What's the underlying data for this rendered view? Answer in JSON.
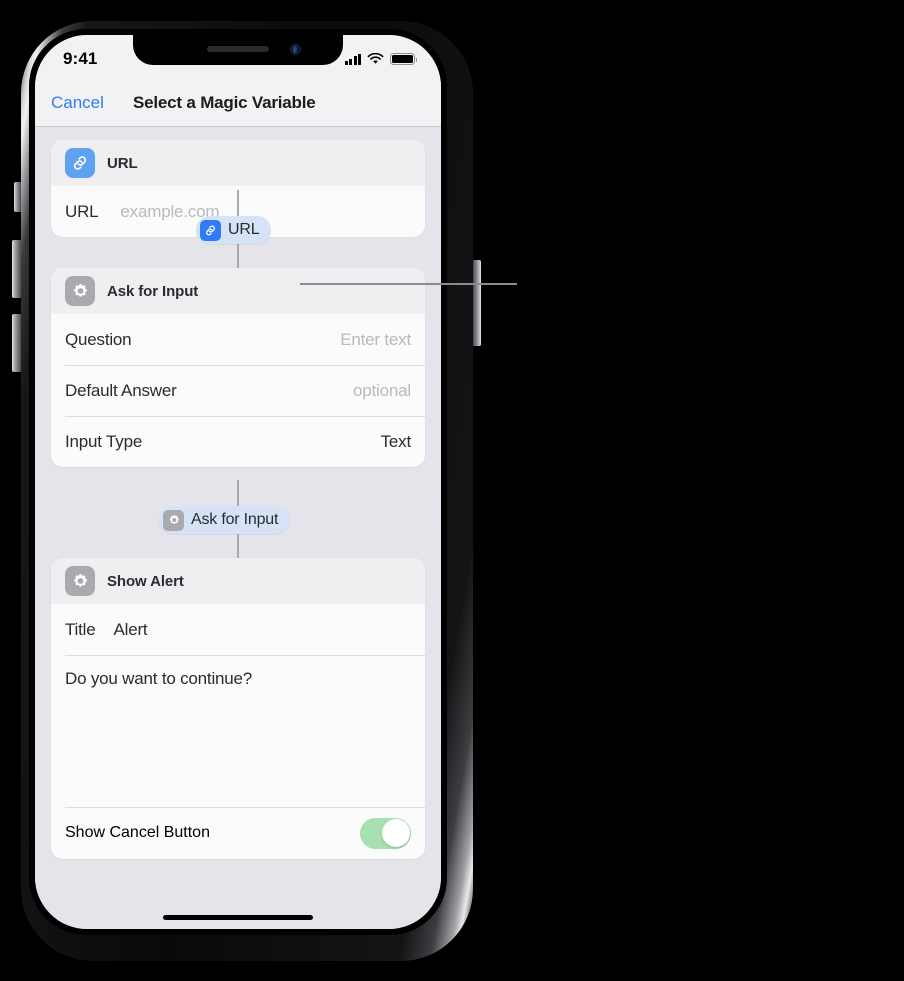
{
  "status_bar": {
    "time": "9:41",
    "cellular_icon": "signal-bars-icon",
    "wifi_icon": "wifi-icon",
    "battery_icon": "battery-icon"
  },
  "nav_bar": {
    "cancel_label": "Cancel",
    "title": "Select a Magic Variable"
  },
  "cards": [
    {
      "id": "url-action",
      "header": {
        "title": "URL",
        "icon": "link-icon",
        "icon_color": "#5ea2f0"
      },
      "rows": [
        {
          "label": "URL",
          "placeholder": "example.com"
        }
      ]
    },
    {
      "id": "ask-for-input-action",
      "header": {
        "title": "Ask for Input",
        "icon": "gear-icon",
        "icon_color": "#a9a9ae"
      },
      "rows": [
        {
          "label": "Question",
          "placeholder": "Enter text"
        },
        {
          "label": "Default Answer",
          "placeholder": "optional"
        },
        {
          "label": "Input Type",
          "value": "Text"
        }
      ]
    },
    {
      "id": "show-alert-action",
      "header": {
        "title": "Show Alert",
        "icon": "gear-icon",
        "icon_color": "#a9a9ae"
      },
      "rows": [
        {
          "label": "Title",
          "value": "Alert"
        }
      ],
      "body_text": "Do you want to continue?",
      "toggle": {
        "label": "Show Cancel Button",
        "state": "on",
        "color": "#a8e0b0"
      }
    }
  ],
  "variable_pills": [
    {
      "id": "url-variable-pill",
      "label": "URL",
      "icon": "link-icon",
      "icon_color": "#2f7cf6",
      "highlighted": true
    },
    {
      "id": "ask-for-input-variable-pill",
      "label": "Ask for Input",
      "icon": "gear-icon",
      "icon_color": "#a9a9ae",
      "highlighted": true
    }
  ],
  "callout": {
    "target": "url-variable-pill",
    "color": "#8b8b90"
  }
}
